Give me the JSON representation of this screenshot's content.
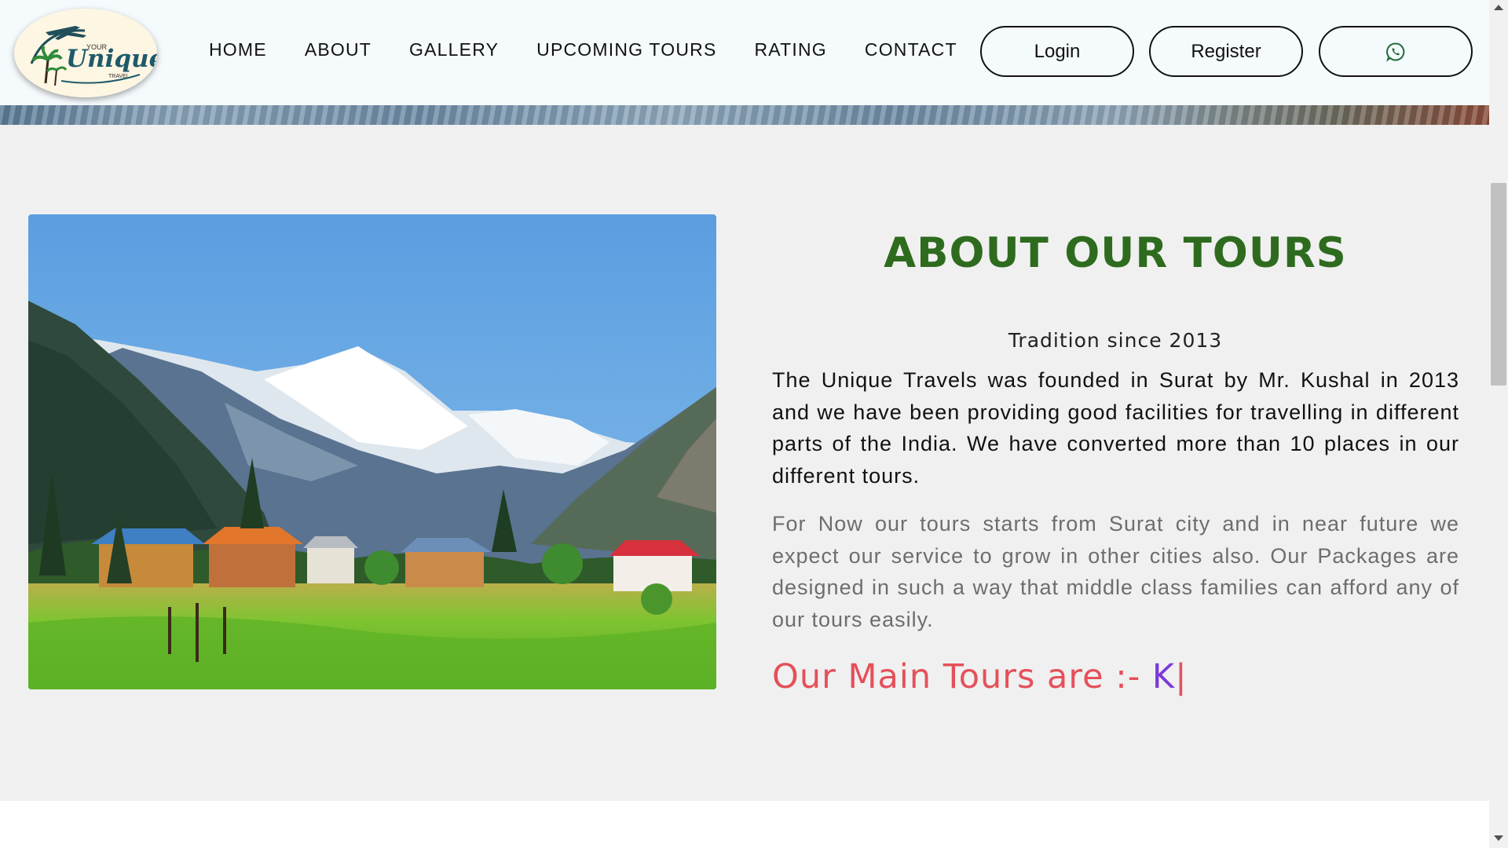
{
  "navbar": {
    "logo": {
      "text_top": "YOUR",
      "text_main": "Unique",
      "text_bottom": "TRAVEL",
      "icon": "airplane-palm-logo"
    },
    "links": [
      "HOME",
      "ABOUT",
      "GALLERY",
      "UPCOMING TOURS",
      "RATING",
      "CONTACT"
    ],
    "login_label": "Login",
    "register_label": "Register",
    "whatsapp_icon": "whatsapp-icon"
  },
  "about": {
    "title": "ABOUT OUR TOURS",
    "tagline": "Tradition since 2013",
    "paragraph1": "The Unique Travels was founded in Surat by Mr. Kushal in 2013 and we have been providing good facilities for travelling in different parts of the India. We have converted more than 10 places in our different tours.",
    "paragraph2": "For Now our tours starts from Surat city and in near future we expect our service to grow in other cities also. Our Packages are designed in such a way that middle class families can afford any of our tours easily.",
    "main_tours_label": "Our Main Tours are :- ",
    "main_tours_typed": "K",
    "cursor": "|"
  },
  "colors": {
    "title_green": "#2e6b1f",
    "main_tours_red": "#e5505a",
    "typed_purple": "#7c3ad8",
    "whatsapp_green": "#1f6b3a"
  }
}
